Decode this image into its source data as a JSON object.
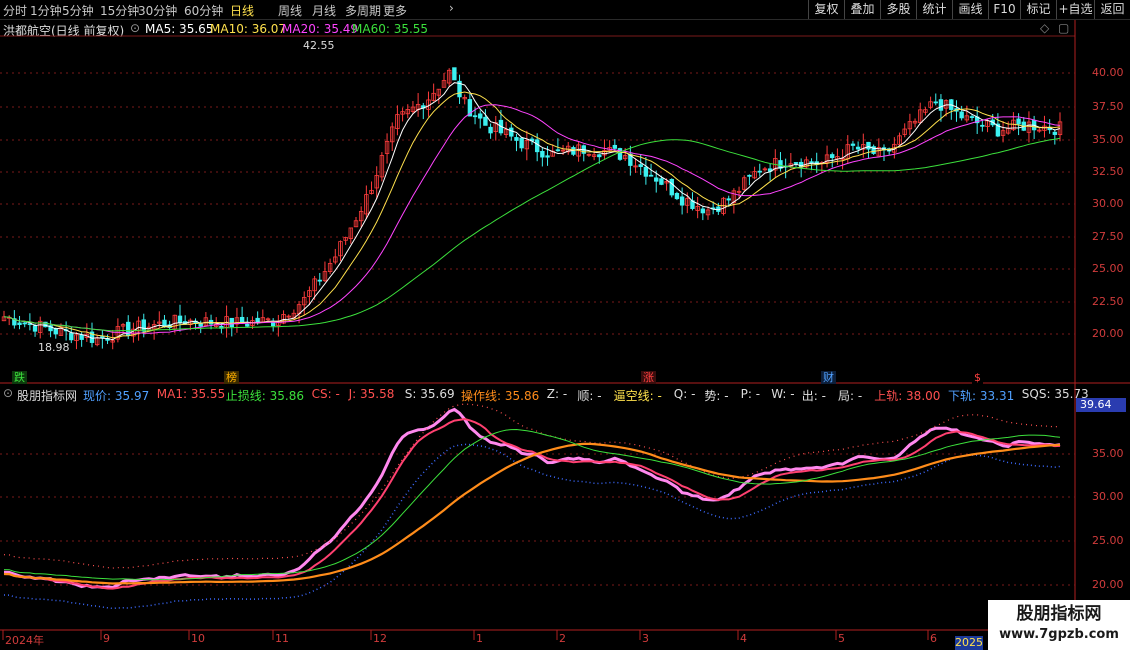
{
  "timeframes": [
    "分时",
    "1分钟",
    "5分钟",
    "15分钟",
    "30分钟",
    "60分钟",
    "日线",
    "周线",
    "月线",
    "多周期",
    "更多"
  ],
  "active_timeframe": "日线",
  "tools": [
    "复权",
    "叠加",
    "多股",
    "统计",
    "画线",
    "F10",
    "+自选",
    "返回"
  ],
  "tool_mark": "标记",
  "main": {
    "title": "洪都航空(日线 前复权)",
    "ma": [
      {
        "label": "MA5: 35.65",
        "color": "#ffffff"
      },
      {
        "label": "MA10: 36.07",
        "color": "#ffe14d"
      },
      {
        "label": "MA20: 35.49",
        "color": "#ff44ff"
      },
      {
        "label": "MA60: 35.55",
        "color": "#3ce03c"
      }
    ],
    "y_ticks": [
      "40.00",
      "37.50",
      "35.00",
      "32.50",
      "30.00",
      "27.50",
      "25.00",
      "22.50",
      "20.00"
    ],
    "high_label": "42.55",
    "low_label": "18.98",
    "events": [
      {
        "label": "跌",
        "color": "#3ce03c",
        "bg": "#0d3a0d"
      },
      {
        "label": "榜",
        "color": "#ffb000",
        "bg": "#3a2a00"
      },
      {
        "label": "涨",
        "color": "#ff4040",
        "bg": "#3a0d0d"
      },
      {
        "label": "财",
        "color": "#50a0ff",
        "bg": "#0d1f3a"
      },
      {
        "label": "$",
        "color": "#ff4040",
        "bg": "#000000"
      }
    ]
  },
  "indicator": {
    "name": "股朋指标网",
    "fields": [
      {
        "label": "现价: 35.97",
        "color": "#50a0ff"
      },
      {
        "label": "MA1: 35.55",
        "color": "#ff5050"
      },
      {
        "label": "止损线: 35.86",
        "color": "#3ce03c"
      },
      {
        "label": "CS: -",
        "color": "#ff5050"
      },
      {
        "label": "J: 35.58",
        "color": "#ff5050"
      },
      {
        "label": "S: 35.69",
        "color": "#dddddd"
      },
      {
        "label": "操作线: 35.86",
        "color": "#ff8c1a"
      },
      {
        "label": "Z: -",
        "color": "#dddddd"
      },
      {
        "label": "顺: -",
        "color": "#dddddd"
      },
      {
        "label": "逼空线: -",
        "color": "#ffe14d"
      },
      {
        "label": "Q: -",
        "color": "#dddddd"
      },
      {
        "label": "势: -",
        "color": "#dddddd"
      },
      {
        "label": "P: -",
        "color": "#dddddd"
      },
      {
        "label": "W: -",
        "color": "#dddddd"
      },
      {
        "label": "出: -",
        "color": "#dddddd"
      },
      {
        "label": "局: -",
        "color": "#dddddd"
      },
      {
        "label": "上轨: 38.00",
        "color": "#ff5050"
      },
      {
        "label": "下轨: 33.31",
        "color": "#50a0ff"
      },
      {
        "label": "SQS: 35.73",
        "color": "#dddddd"
      }
    ],
    "price_tag": "39.64",
    "y_ticks": [
      "35.00",
      "30.00",
      "25.00",
      "20.00"
    ]
  },
  "x_axis": [
    "2024年",
    "9",
    "10",
    "11",
    "12",
    "1",
    "2",
    "3",
    "4",
    "5",
    "6"
  ],
  "x_badge": "2025",
  "watermark": {
    "line1": "股朋指标网",
    "line2": "www.7gpzb.com"
  },
  "colors": {
    "up": "#ff3c3c",
    "down": "#3cf0f0",
    "grid": "#7a1a1a"
  }
}
